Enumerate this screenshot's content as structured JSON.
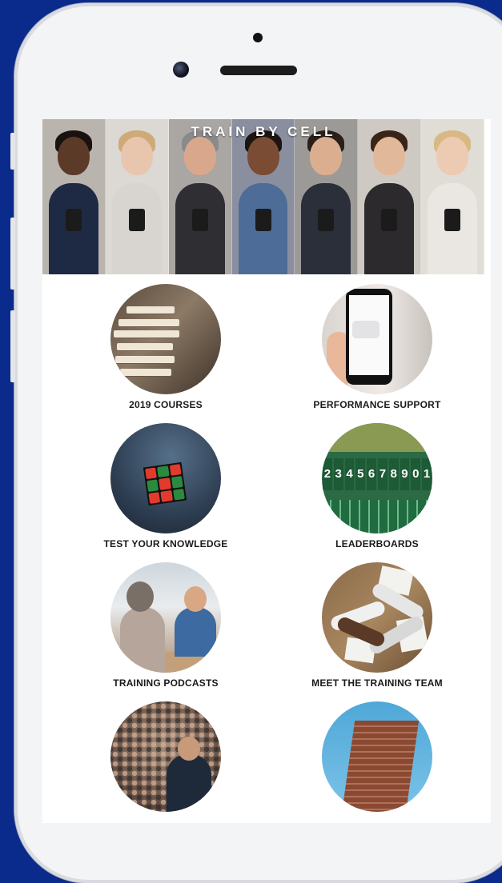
{
  "banner": {
    "title": "TRAIN BY CELL"
  },
  "tiles": [
    {
      "label": "2019 COURSES",
      "icon": "books-icon"
    },
    {
      "label": "PERFORMANCE SUPPORT",
      "icon": "phone-message-icon"
    },
    {
      "label": "TEST YOUR KNOWLEDGE",
      "icon": "rubiks-cube-icon"
    },
    {
      "label": "LEADERBOARDS",
      "icon": "scoreboard-icon"
    },
    {
      "label": "TRAINING PODCASTS",
      "icon": "podcast-icon"
    },
    {
      "label": "MEET THE TRAINING TEAM",
      "icon": "team-fists-icon"
    },
    {
      "label": "",
      "icon": "audience-icon"
    },
    {
      "label": "",
      "icon": "skyscraper-icon"
    }
  ],
  "colors": {
    "background": "#0a2a8c",
    "device": "#f3f4f6",
    "label": "#1a1a1a"
  },
  "leaderboard_numbers": [
    "1",
    "2",
    "3",
    "4",
    "5",
    "6",
    "7",
    "8",
    "9",
    "0"
  ]
}
